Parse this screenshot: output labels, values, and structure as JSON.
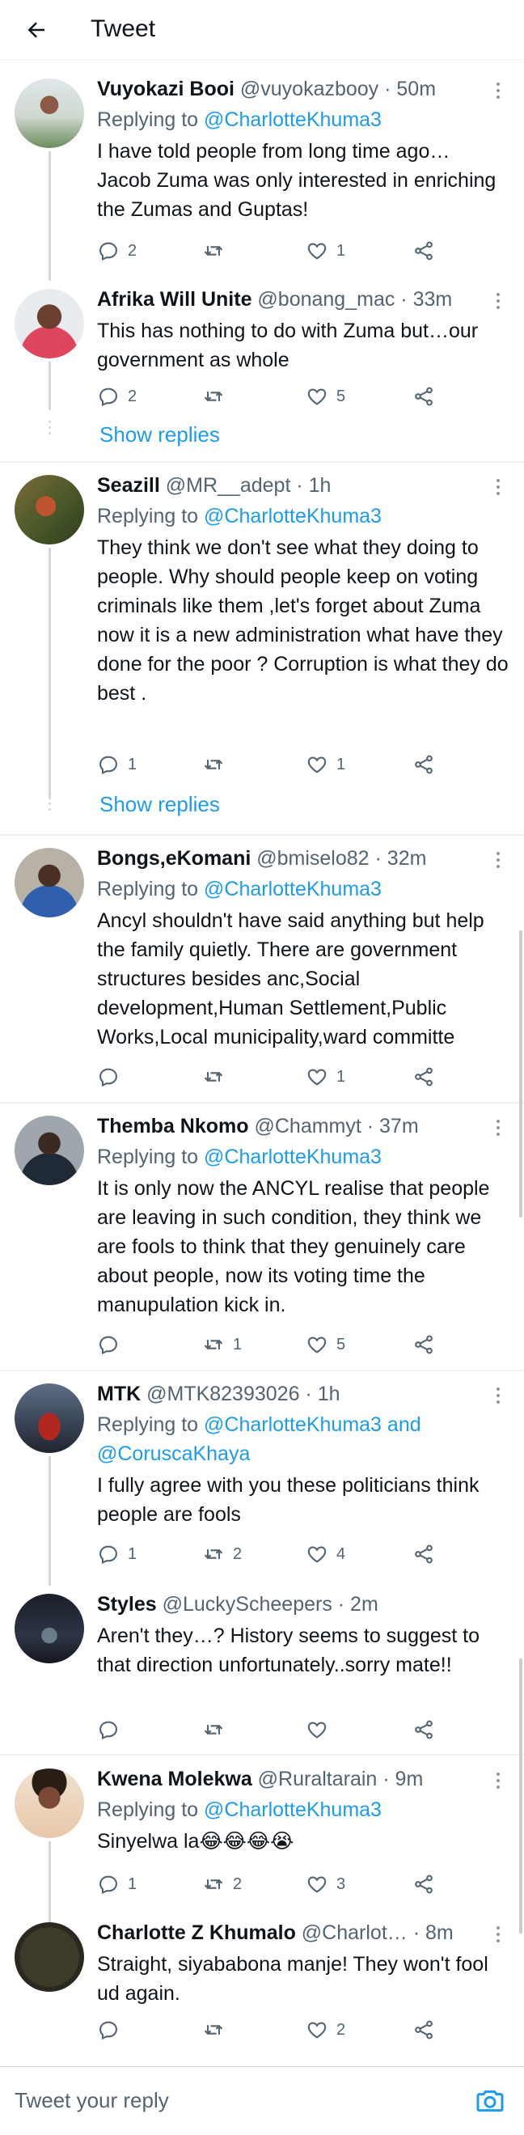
{
  "header": {
    "title": "Tweet",
    "back_icon": "arrow-left-icon"
  },
  "composer": {
    "placeholder": "Tweet your reply",
    "camera_icon": "camera-icon"
  },
  "tweets": [
    {
      "name": "Vuyokazi Booi",
      "meta": " @vuyokazbooy · 50m",
      "reply_prefix": "Replying to ",
      "reply_to": "@CharlotteKhuma3",
      "text": "I have told people from long time ago… Jacob Zuma was only interested in enriching the Zumas and Guptas!",
      "replies": "2",
      "retweets": "",
      "likes": "1"
    },
    {
      "name": "Afrika Will Unite",
      "meta": " @bonang_mac · 33m",
      "text": "This has nothing to do with Zuma but…our government as whole",
      "replies": "2",
      "retweets": "",
      "likes": "5",
      "show_replies": "Show replies"
    },
    {
      "name": "Seazill",
      "meta": " @MR__adept · 1h",
      "reply_prefix": "Replying to ",
      "reply_to": "@CharlotteKhuma3",
      "text": "They think we don't see what they doing to people. Why should people keep on voting criminals like them ,let's forget about Zuma now it is a new administration what have they done for the poor ? Corruption is what they do best .",
      "replies": "1",
      "retweets": "",
      "likes": "1",
      "show_replies": "Show replies"
    },
    {
      "name": "Bongs,eKomani",
      "meta": " @bmiselo82 · 32m",
      "reply_prefix": "Replying to ",
      "reply_to": "@CharlotteKhuma3",
      "text": "Ancyl shouldn't have said anything but help the family quietly. There are government structures besides anc,Social development,Human Settlement,Public Works,Local municipality,ward committe",
      "replies": "",
      "retweets": "",
      "likes": "1"
    },
    {
      "name": "Themba Nkomo",
      "meta": " @Chammyt · 37m",
      "reply_prefix": "Replying to ",
      "reply_to": "@CharlotteKhuma3",
      "text": "It is only now the ANCYL realise that people are leaving in such condition, they think we are fools to think that they genuinely care about people, now its voting time the manupulation kick in.",
      "replies": "",
      "retweets": "1",
      "likes": "5"
    },
    {
      "name": "MTK",
      "meta": " @MTK82393026 · 1h",
      "reply_prefix": "Replying to ",
      "reply_to": "@CharlotteKhuma3 and",
      "reply_to_2": "@CoruscaKhaya",
      "text": "I fully agree with you these politicians think people are fools",
      "replies": "1",
      "retweets": "2",
      "likes": "4"
    },
    {
      "name": "Styles",
      "meta": " @LuckyScheepers · 2m",
      "text": "Aren't they…? History seems to suggest to that direction unfortunately..sorry mate!!",
      "replies": "",
      "retweets": "",
      "likes": ""
    },
    {
      "name": "Kwena Molekwa",
      "meta": " @Ruraltarain · 9m",
      "reply_prefix": "Replying to ",
      "reply_to": "@CharlotteKhuma3",
      "text": "Sinyelwa la😂😂😂😭",
      "replies": "1",
      "retweets": "2",
      "likes": "3"
    },
    {
      "name": "Charlotte Z Khumalo",
      "meta": " @Charlot… · 8m",
      "text": "Straight, siyababona manje! They won't fool ud again.",
      "replies": "",
      "retweets": "",
      "likes": "2"
    }
  ],
  "colors": {
    "accent": "#1d9bf0",
    "muted": "#536471",
    "divider": "#eff3f4"
  }
}
